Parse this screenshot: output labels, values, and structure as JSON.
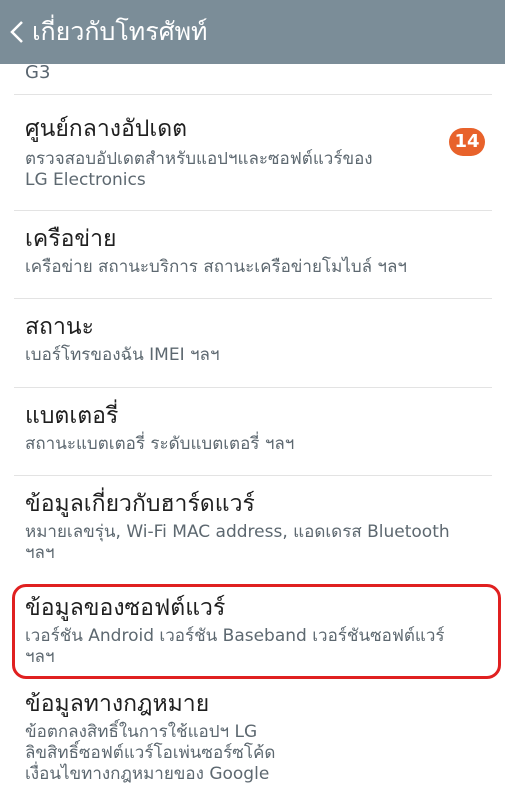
{
  "header": {
    "title": "เกี่ยวกับโทรศัพท์"
  },
  "partial_item": {
    "text": "G3"
  },
  "items": [
    {
      "title": "ศูนย์กลางอัปเดต",
      "subtitle_line1": "ตรวจสอบอัปเดตสำหรับแอปฯและซอฟต์แวร์ของ",
      "subtitle_line2": "LG Electronics",
      "badge": "14"
    },
    {
      "title": "เครือข่าย",
      "subtitle_line1": "เครือข่าย สถานะบริการ สถานะเครือข่ายโมไบล์ ฯลฯ"
    },
    {
      "title": "สถานะ",
      "subtitle_line1": "เบอร์โทรของฉัน IMEI ฯลฯ"
    },
    {
      "title": "แบตเตอรี่",
      "subtitle_line1": "สถานะแบตเตอรี่ ระดับแบตเตอรี่ ฯลฯ"
    },
    {
      "title": "ข้อมูลเกี่ยวกับฮาร์ดแวร์",
      "subtitle_line1": "หมายเลขรุ่น, Wi-Fi MAC address, แอดเดรส Bluetooth",
      "subtitle_line2": "ฯลฯ"
    },
    {
      "title": "ข้อมูลของซอฟต์แวร์",
      "subtitle_line1": "เวอร์ชัน Android เวอร์ชัน Baseband เวอร์ชันซอฟต์แวร์",
      "subtitle_line2": "ฯลฯ"
    },
    {
      "title": "ข้อมูลทางกฎหมาย",
      "subtitle_line1": "ข้อตกลงสิทธิ์ในการใช้แอปฯ LG",
      "subtitle_line2": "ลิขสิทธิ์ซอฟต์แวร์โอเพ่นซอร์ซโค้ด",
      "subtitle_line3": "เงื่อนไขทางกฎหมายของ Google"
    }
  ],
  "colors": {
    "header_bg": "#7b8d98",
    "badge_bg": "#e8622b",
    "highlight_border": "#e02020"
  }
}
